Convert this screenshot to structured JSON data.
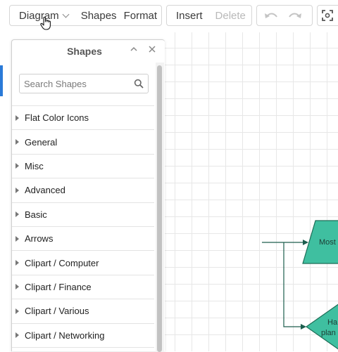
{
  "toolbar": {
    "diagram_label": "Diagram",
    "shapes_label": "Shapes",
    "format_label": "Format",
    "insert_label": "Insert",
    "delete_label": "Delete",
    "undo_icon": "undo-icon",
    "redo_icon": "redo-icon",
    "fit_icon": "fit-screen-icon"
  },
  "shapes_panel": {
    "title": "Shapes",
    "search_placeholder": "Search Shapes",
    "items": [
      {
        "label": "Flat Color Icons"
      },
      {
        "label": "General"
      },
      {
        "label": "Misc"
      },
      {
        "label": "Advanced"
      },
      {
        "label": "Basic"
      },
      {
        "label": "Arrows"
      },
      {
        "label": "Clipart / Computer"
      },
      {
        "label": "Clipart / Finance"
      },
      {
        "label": "Clipart / Various"
      },
      {
        "label": "Clipart / Networking"
      }
    ]
  },
  "diagram": {
    "process_shape_label": "Most",
    "decision_shape_label_line1": "Ha",
    "decision_shape_label_line2": "plan",
    "shape_fill": "#3fbfa0",
    "shape_stroke": "#1d6e57",
    "connector_color": "#1d5e4e"
  },
  "colors": {
    "accent": "#2a7ad8",
    "grid": "#e7e7e7",
    "border": "#d6d6d6"
  }
}
